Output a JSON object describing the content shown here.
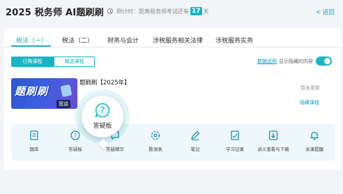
{
  "header": {
    "title": "2025 税务师 AI题刷刷",
    "countdown_prefix": "倒计时：距离税务师考试还有",
    "countdown_days": "17",
    "countdown_suffix": "天",
    "back_label": "< 返回"
  },
  "tabs": [
    {
      "label": "税法（一）",
      "active": true
    },
    {
      "label": "税法（二）",
      "active": false
    },
    {
      "label": "财务与会计",
      "active": false
    },
    {
      "label": "涉税服务相关法律",
      "active": false
    },
    {
      "label": "涉税服务实务",
      "active": false
    }
  ],
  "segments": {
    "purchased": "已购课程",
    "gifted": "赠送课程"
  },
  "options": {
    "data_link": "数据说明",
    "show_hidden": "显示隐藏的内容"
  },
  "course": {
    "thumb_text": "题刷刷",
    "thumb_badge": "宽谈",
    "title": "题刷刷【2025年】",
    "status": "暂未更新",
    "hide_label": "隐藏课程"
  },
  "tools": [
    {
      "label": "题库",
      "icon": "question-bank-icon"
    },
    {
      "label": "答疑板",
      "icon": "qa-board-icon"
    },
    {
      "label": "答疑精华",
      "icon": "qa-highlights-icon"
    },
    {
      "label": "勘误表",
      "icon": "errata-icon"
    },
    {
      "label": "笔记",
      "icon": "notes-icon"
    },
    {
      "label": "学习记录",
      "icon": "study-record-icon"
    },
    {
      "label": "讲义查看与下载",
      "icon": "download-icon"
    },
    {
      "label": "关课提醒",
      "icon": "bell-icon"
    }
  ],
  "bubble": {
    "label": "答疑板",
    "icon": "question-bubble-icon"
  },
  "colors": {
    "accent": "#1ab5c4",
    "link": "#1aa0c4",
    "toolbar_bg": "#eef7fb"
  }
}
